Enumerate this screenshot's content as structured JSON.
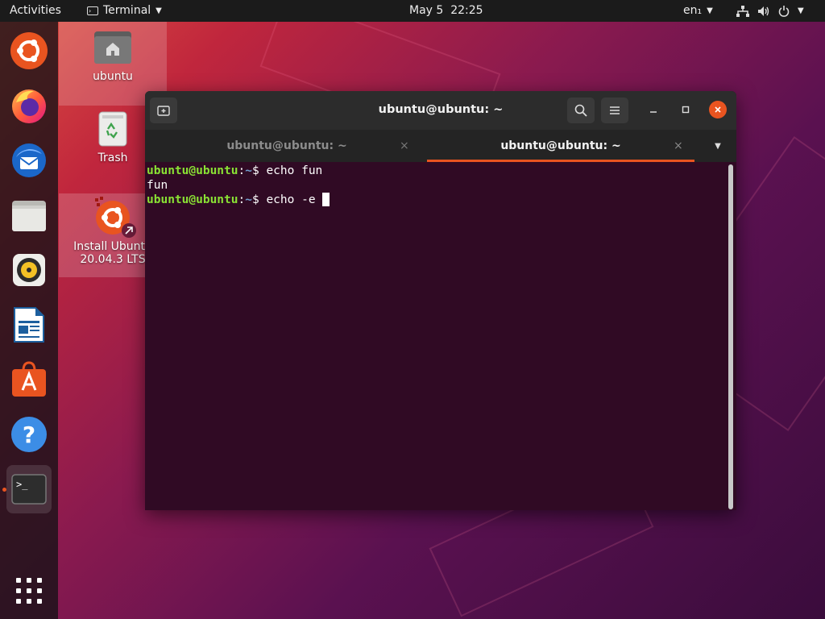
{
  "topbar": {
    "activities": "Activities",
    "app_name": "Terminal",
    "datetime": "May 5  22:25",
    "lang": "en₁"
  },
  "desktop": {
    "home_label": "ubuntu",
    "trash_label": "Trash",
    "install_label_line1": "Install Ubuntu",
    "install_label_line2": "20.04.3 LTS"
  },
  "dock": {
    "items": [
      "ubuntu-installer",
      "firefox",
      "thunderbird",
      "files",
      "rhythmbox",
      "libreoffice-writer",
      "ubuntu-software",
      "help",
      "terminal"
    ]
  },
  "window": {
    "title": "ubuntu@ubuntu: ~",
    "tabs": [
      {
        "label": "ubuntu@ubuntu: ~",
        "active": false
      },
      {
        "label": "ubuntu@ubuntu: ~",
        "active": true
      }
    ]
  },
  "terminal": {
    "lines": [
      {
        "user": "ubuntu@ubuntu",
        "sep": ":",
        "path": "~",
        "prompt": "$ ",
        "cmd": "echo fun"
      },
      {
        "output": "fun"
      },
      {
        "user": "ubuntu@ubuntu",
        "sep": ":",
        "path": "~",
        "prompt": "$ ",
        "cmd": "echo -e "
      }
    ]
  },
  "colors": {
    "accent": "#e95420",
    "terminal_bg": "#300a24",
    "prompt_user": "#8ae234",
    "prompt_path": "#729fcf"
  }
}
